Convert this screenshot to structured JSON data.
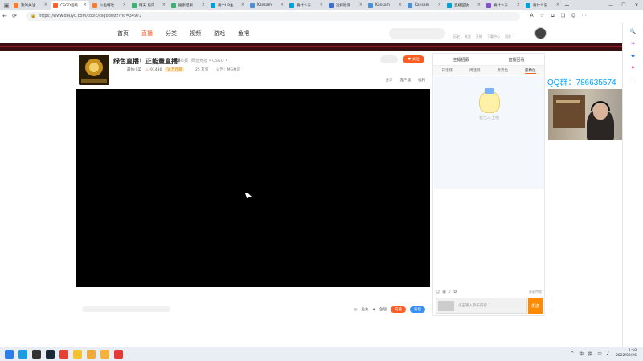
{
  "browser": {
    "tabs": [
      {
        "label": "我的关注",
        "color": "#ff7a2a",
        "active": false
      },
      {
        "label": "CSGO超级",
        "color": "#ff5d23",
        "active": true
      },
      {
        "label": "斗鱼特攻",
        "color": "#ff7a2a",
        "active": false
      },
      {
        "label": "精天 局内",
        "color": "#3bb273",
        "active": false
      },
      {
        "label": "搜索结果",
        "color": "#3bb273",
        "active": false
      },
      {
        "label": "要个UP主",
        "color": "#00a1d6",
        "active": false
      },
      {
        "label": "Kansam",
        "color": "#4a90d9",
        "active": false
      },
      {
        "label": "要什么东",
        "color": "#00a1d6",
        "active": false
      },
      {
        "label": "选择检测",
        "color": "#3a6ed8",
        "active": false
      },
      {
        "label": "Kansam",
        "color": "#4a90d9",
        "active": false
      },
      {
        "label": "Kansam",
        "color": "#4a90d9",
        "active": false
      },
      {
        "label": "直播回放",
        "color": "#00a1d6",
        "active": false
      },
      {
        "label": "要什么东",
        "color": "#8a4bd8",
        "active": false
      },
      {
        "label": "要什么东",
        "color": "#00a1d6",
        "active": false
      }
    ],
    "new_tab": "+",
    "url": "https://www.douyu.com/topic/csgodwzz?rid=34972",
    "window_controls": [
      "—",
      "☐",
      "✕"
    ]
  },
  "site": {
    "nav": [
      {
        "label": "首页",
        "active": false
      },
      {
        "label": "直播",
        "active": true
      },
      {
        "label": "分类",
        "active": false
      },
      {
        "label": "视频",
        "active": false
      },
      {
        "label": "游戏",
        "active": false
      },
      {
        "label": "鱼吧",
        "active": false
      }
    ],
    "header_links": [
      "历史",
      "关注",
      "开播",
      "下载中心",
      "消息"
    ]
  },
  "room": {
    "title": "绿色直播！正能量直播！",
    "report": "举报",
    "category": "网游竞技 • CSGO •",
    "host_name": "最帅小菜",
    "heat": "91436",
    "level_badge": "V 万元哥",
    "fans": "25 友邻",
    "notice": "公告：MG共识",
    "follow_label": "♥ 关注",
    "actions": [
      "分享",
      "客户端",
      "福利"
    ]
  },
  "gift_bar": {
    "right_items": [
      "鱼丸",
      "鱼翅"
    ],
    "recharge": "充值",
    "backpack": "背包"
  },
  "chat": {
    "top_tabs": [
      "主播招募",
      "直播回看"
    ],
    "rank_tabs": [
      {
        "label": "日活跃",
        "active": false
      },
      {
        "label": "周活跃",
        "active": false
      },
      {
        "label": "贵宾位",
        "active": false
      },
      {
        "label": "座椅位",
        "active": true
      }
    ],
    "rank_note": "暂无人上榜",
    "block_gift": "屏蔽特效",
    "input_placeholder": "点击输入聊天内容",
    "send": "发送"
  },
  "overlay": {
    "qq_text": "QQ群：786635574"
  },
  "taskbar": {
    "apps": [
      {
        "name": "start",
        "color": "#2b7de9"
      },
      {
        "name": "edge",
        "color": "#1f9be0"
      },
      {
        "name": "obs",
        "color": "#333333"
      },
      {
        "name": "steam",
        "color": "#1b2838"
      },
      {
        "name": "chrome",
        "color": "#e44134"
      },
      {
        "name": "explorer",
        "color": "#f4c430"
      },
      {
        "name": "app-cat",
        "color": "#f2a93b"
      },
      {
        "name": "app-cat2",
        "color": "#f5b041"
      },
      {
        "name": "app-red",
        "color": "#e53935"
      }
    ],
    "tray": [
      "^",
      "中",
      "拼"
    ],
    "time": "1:58",
    "date": "2022/02/26"
  }
}
